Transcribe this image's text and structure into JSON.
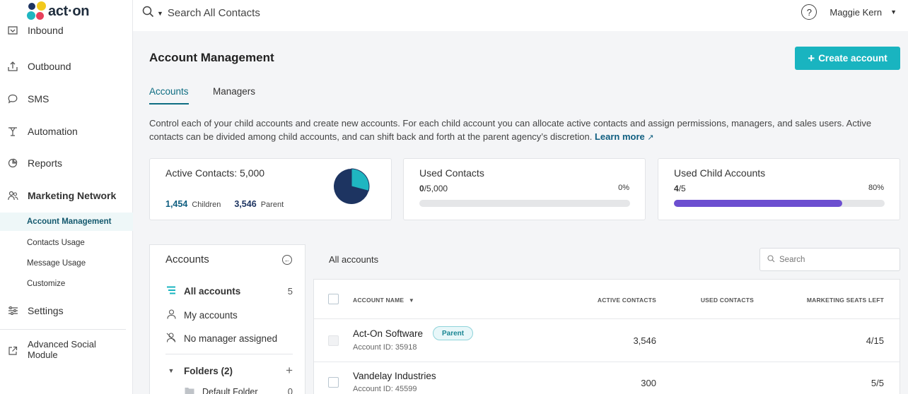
{
  "app": {
    "logo_text": "act·on"
  },
  "topbar": {
    "search_placeholder": "Search All Contacts",
    "user_name": "Maggie Kern"
  },
  "sidebar": {
    "items": [
      {
        "label": "Inbound",
        "icon": "inbox-icon"
      },
      {
        "label": "Outbound",
        "icon": "upload-icon"
      },
      {
        "label": "SMS",
        "icon": "chat-bubble-icon"
      },
      {
        "label": "Automation",
        "icon": "automation-icon"
      },
      {
        "label": "Reports",
        "icon": "pie-chart-icon"
      },
      {
        "label": "Marketing Network",
        "icon": "network-icon"
      },
      {
        "label": "Settings",
        "icon": "sliders-icon"
      },
      {
        "label": "Advanced Social Module",
        "icon": "external-link-icon"
      }
    ],
    "sub_items": [
      {
        "label": "Account Management"
      },
      {
        "label": "Contacts Usage"
      },
      {
        "label": "Message Usage"
      },
      {
        "label": "Customize"
      }
    ]
  },
  "main": {
    "title": "Account Management",
    "create_button": "Create account",
    "tabs": [
      {
        "label": "Accounts"
      },
      {
        "label": "Managers"
      }
    ],
    "description": "Control each of your child accounts and create new accounts. For each child account you can allocate active contacts and assign permissions, managers, and sales users. Active contacts can be divided among child accounts, and can shift back and forth at the parent agency’s discretion.",
    "learn_more": "Learn more"
  },
  "cards": {
    "active_contacts": {
      "title": "Active Contacts: 5,000",
      "children_value": "1,454",
      "children_label": "Children",
      "parent_value": "3,546",
      "parent_label": "Parent",
      "pie": {
        "children": 1454,
        "parent": 3546,
        "children_color": "#1fb6c1",
        "parent_color": "#1d3461"
      }
    },
    "used_contacts": {
      "title": "Used Contacts",
      "used": "0",
      "total": "/5,000",
      "percent": "0%",
      "fraction": 0
    },
    "used_child_accounts": {
      "title": "Used Child Accounts",
      "used": "4",
      "total": "/5",
      "percent": "80%",
      "fraction": 0.8,
      "color": "#6c4fd0"
    }
  },
  "accounts_panel": {
    "title": "Accounts",
    "all_accounts": {
      "label": "All accounts",
      "count": "5"
    },
    "my_accounts": {
      "label": "My accounts"
    },
    "no_manager": {
      "label": "No manager assigned"
    },
    "folders": {
      "label": "Folders (2)"
    },
    "default_folder": {
      "label": "Default Folder",
      "count": "0"
    }
  },
  "table": {
    "heading": "All accounts",
    "search_placeholder": "Search",
    "columns": {
      "account_name": "ACCOUNT NAME",
      "active_contacts": "ACTIVE CONTACTS",
      "used_contacts": "USED CONTACTS",
      "marketing_seats": "MARKETING SEATS LEFT"
    },
    "rows": [
      {
        "name": "Act-On Software",
        "badge": "Parent",
        "account_id": "Account ID: 35918",
        "active_contacts": "3,546",
        "used_contacts": "",
        "seats": "4/15"
      },
      {
        "name": "Vandelay Industries",
        "account_id": "Account ID: 45599",
        "active_contacts": "300",
        "used_contacts": "",
        "seats": "5/5"
      }
    ]
  }
}
